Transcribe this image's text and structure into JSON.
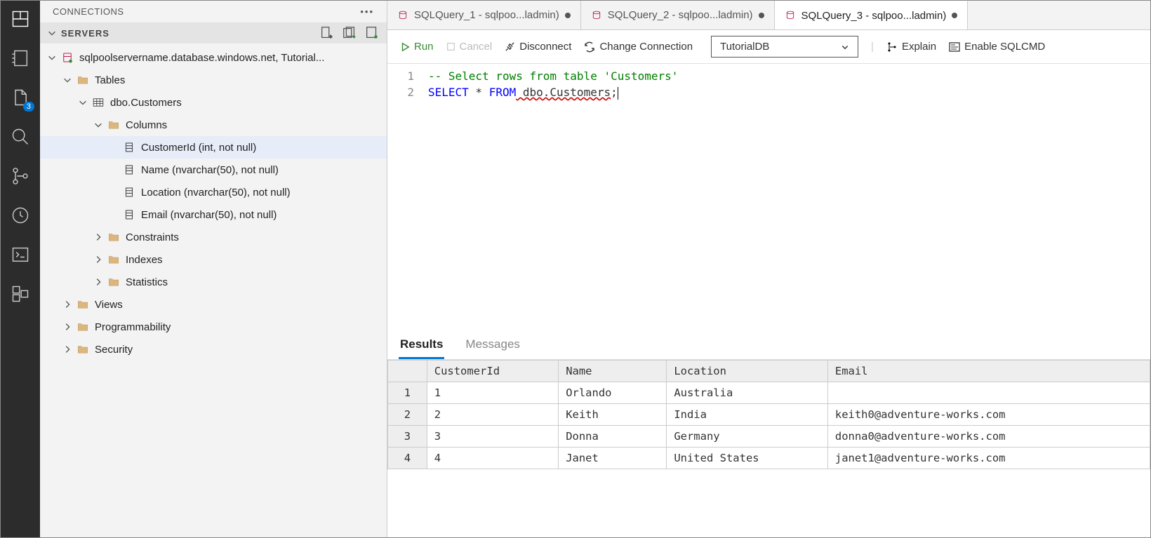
{
  "activity": {
    "explorer_badge": "3"
  },
  "sidebar": {
    "title": "CONNECTIONS",
    "section": "SERVERS",
    "server": "sqlpoolservername.database.windows.net, Tutorial...",
    "tablesNode": "Tables",
    "tableName": "dbo.Customers",
    "columnsNode": "Columns",
    "columns": [
      "CustomerId (int, not null)",
      "Name (nvarchar(50), not null)",
      "Location (nvarchar(50), not null)",
      "Email (nvarchar(50), not null)"
    ],
    "constraints": "Constraints",
    "indexes": "Indexes",
    "statistics": "Statistics",
    "views": "Views",
    "programmability": "Programmability",
    "security": "Security"
  },
  "tabs": [
    "SQLQuery_1 - sqlpoo...ladmin)",
    "SQLQuery_2 - sqlpoo...ladmin)",
    "SQLQuery_3 - sqlpoo...ladmin)"
  ],
  "toolbar": {
    "run": "Run",
    "cancel": "Cancel",
    "disconnect": "Disconnect",
    "change": "Change Connection",
    "db": "TutorialDB",
    "explain": "Explain",
    "sqlcmd": "Enable SQLCMD"
  },
  "code": {
    "l1": "1",
    "l2": "2",
    "comment": "-- Select rows from table 'Customers'",
    "select": "SELECT",
    "star": " * ",
    "from": "FROM",
    "target": " dbo.Customers",
    "semi": ";"
  },
  "resultTabs": {
    "results": "Results",
    "messages": "Messages"
  },
  "grid": {
    "headers": [
      "CustomerId",
      "Name",
      "Location",
      "Email"
    ],
    "rows": [
      [
        "1",
        "1",
        "Orlando",
        "Australia",
        ""
      ],
      [
        "2",
        "2",
        "Keith",
        "India",
        "keith0@adventure-works.com"
      ],
      [
        "3",
        "3",
        "Donna",
        "Germany",
        "donna0@adventure-works.com"
      ],
      [
        "4",
        "4",
        "Janet",
        "United States",
        "janet1@adventure-works.com"
      ]
    ]
  }
}
